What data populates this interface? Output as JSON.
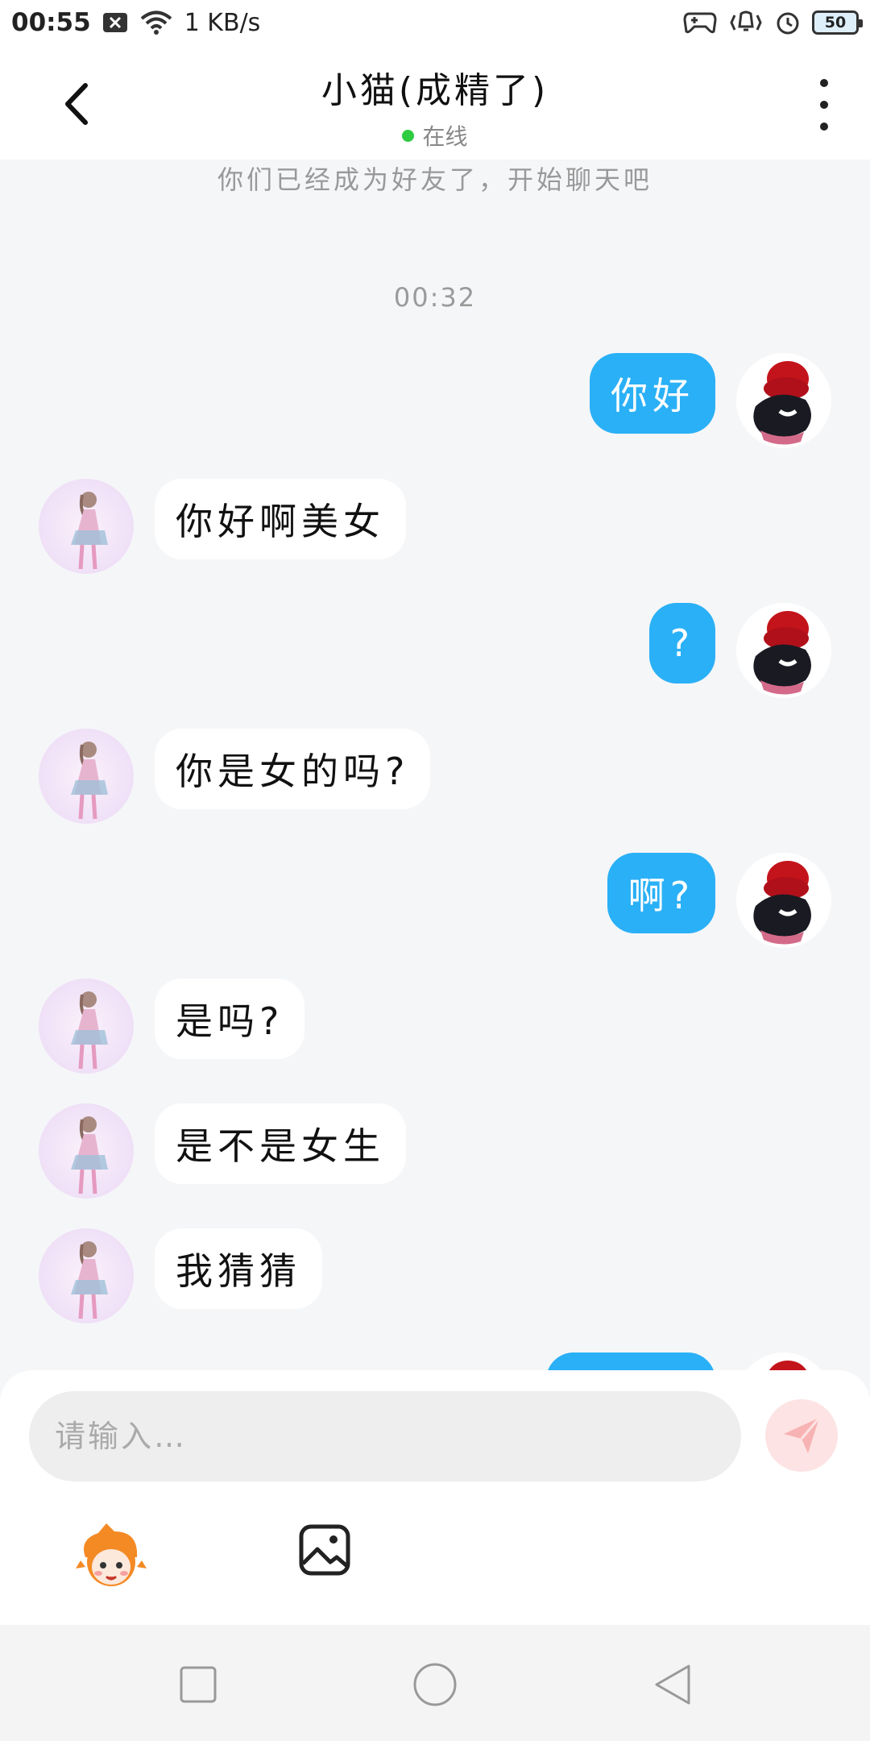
{
  "status_bar": {
    "time": "00:55",
    "net_speed": "1 KB/s",
    "battery": "50"
  },
  "header": {
    "title": "小猫(成精了)",
    "status": "在线"
  },
  "chat": {
    "system_note": "你们已经成为好友了，开始聊天吧",
    "timestamp": "00:32",
    "messages": [
      {
        "from": "me",
        "text": "你好"
      },
      {
        "from": "them",
        "text": "你好啊美女"
      },
      {
        "from": "me",
        "text": "?"
      },
      {
        "from": "them",
        "text": "你是女的吗?"
      },
      {
        "from": "me",
        "text": "啊?"
      },
      {
        "from": "them",
        "text": "是吗?"
      },
      {
        "from": "them",
        "text": "是不是女生"
      },
      {
        "from": "them",
        "text": "我猜猜"
      }
    ]
  },
  "input": {
    "placeholder": "请输入…"
  },
  "colors": {
    "my_bubble": "#2ab0f6",
    "their_bubble": "#ffffff",
    "online": "#2ecc40",
    "send_button": "#fde3e3"
  },
  "icons": {
    "back": "chevron-left-icon",
    "more": "more-vertical-icon",
    "send": "paper-plane-icon",
    "emoji": "mascot-emoji-icon",
    "image": "image-icon"
  }
}
